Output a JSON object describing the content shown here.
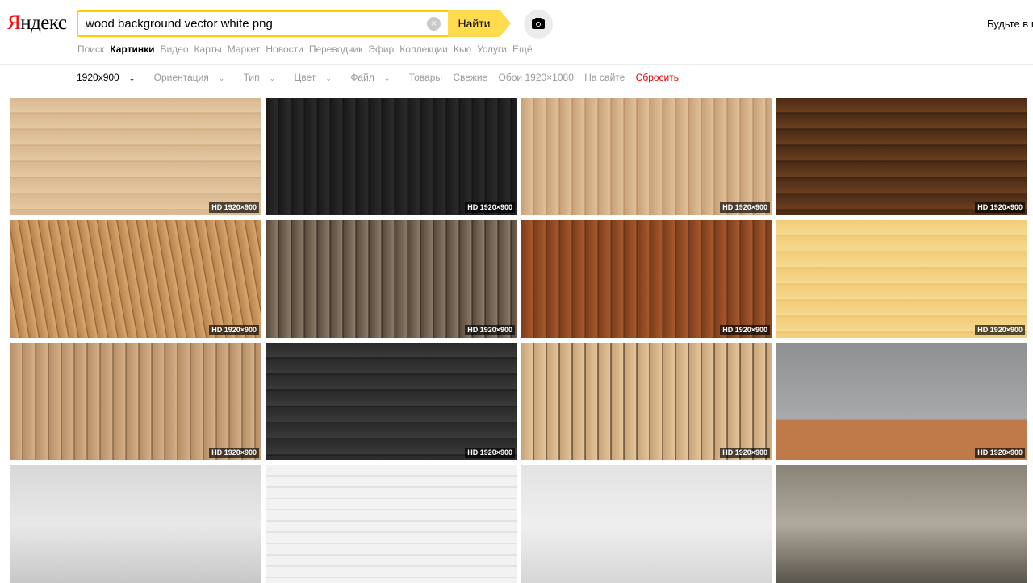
{
  "header": {
    "logo_first": "Я",
    "logo_rest": "ндекс",
    "search_value": "wood background vector white png",
    "clear_icon": "×",
    "find_label": "Найти",
    "promo": "Будьте в г"
  },
  "nav": [
    {
      "label": "Поиск",
      "active": false
    },
    {
      "label": "Картинки",
      "active": true
    },
    {
      "label": "Видео",
      "active": false
    },
    {
      "label": "Карты",
      "active": false
    },
    {
      "label": "Маркет",
      "active": false
    },
    {
      "label": "Новости",
      "active": false
    },
    {
      "label": "Переводчик",
      "active": false
    },
    {
      "label": "Эфир",
      "active": false
    },
    {
      "label": "Коллекции",
      "active": false
    },
    {
      "label": "Кью",
      "active": false
    },
    {
      "label": "Услуги",
      "active": false
    },
    {
      "label": "Ещё",
      "active": false
    }
  ],
  "filters": {
    "size": "1920x900",
    "orientation": "Ориентация",
    "type": "Тип",
    "color": "Цвет",
    "file": "Файл",
    "goods": "Товары",
    "fresh": "Свежие",
    "wallpaper": "Обои 1920×1080",
    "on_site": "На сайте",
    "reset": "Сбросить"
  },
  "images": {
    "badge": "HD 1920×900",
    "tiles": [
      {
        "name": "light-wood-planks",
        "colors": [
          "#d9b88f",
          "#e4c8a2",
          "#caa57a"
        ],
        "badge": true
      },
      {
        "name": "black-wood-planks",
        "colors": [
          "#1a1a1a",
          "#2b2b2b",
          "#111111"
        ],
        "badge": true
      },
      {
        "name": "wood-wall-floor-room",
        "colors": [
          "#c9a27a",
          "#e0bf98",
          "#b3865c"
        ],
        "badge": true
      },
      {
        "name": "dark-brown-wood",
        "colors": [
          "#4a2a14",
          "#6b3f1f",
          "#2e1a0c"
        ],
        "badge": true
      },
      {
        "name": "wood-floor-perspective",
        "colors": [
          "#b88450",
          "#d9a56c",
          "#8a5a2e"
        ],
        "badge": true
      },
      {
        "name": "old-wood-wall-dark",
        "colors": [
          "#5a4a3c",
          "#8a7a68",
          "#2a2018"
        ],
        "badge": true
      },
      {
        "name": "red-brown-wood-planks",
        "colors": [
          "#7a3e1c",
          "#a8582b",
          "#5a2c12"
        ],
        "badge": true
      },
      {
        "name": "pale-yellow-wood",
        "colors": [
          "#f0cc7a",
          "#f7d98e",
          "#e6bb66"
        ],
        "badge": true
      },
      {
        "name": "knotty-wood-wall",
        "colors": [
          "#b89068",
          "#d3ae86",
          "#6e5036"
        ],
        "badge": true
      },
      {
        "name": "dark-gray-wood",
        "colors": [
          "#2a2a2a",
          "#3a3a3a",
          "#151515"
        ],
        "badge": true
      },
      {
        "name": "wood-room-spotlight",
        "colors": [
          "#c8a478",
          "#e4c49a",
          "#2a1c10"
        ],
        "badge": true
      },
      {
        "name": "concrete-wall-wood-floor",
        "colors": [
          "#8f9092",
          "#a8a9ab",
          "#c07a4a"
        ],
        "badge": true
      },
      {
        "name": "white-concrete",
        "colors": [
          "#d8d8d8",
          "#e8e8e8",
          "#c8c8c8"
        ],
        "badge": false
      },
      {
        "name": "white-brick-wall",
        "colors": [
          "#e6e6e6",
          "#f2f2f2",
          "#d2d2d2"
        ],
        "badge": false
      },
      {
        "name": "white-wall",
        "colors": [
          "#e3e3e3",
          "#efefef",
          "#d6d6d6"
        ],
        "badge": false
      },
      {
        "name": "grunge-wall",
        "colors": [
          "#8a8478",
          "#b0aa9c",
          "#5a554c"
        ],
        "badge": false
      }
    ]
  }
}
